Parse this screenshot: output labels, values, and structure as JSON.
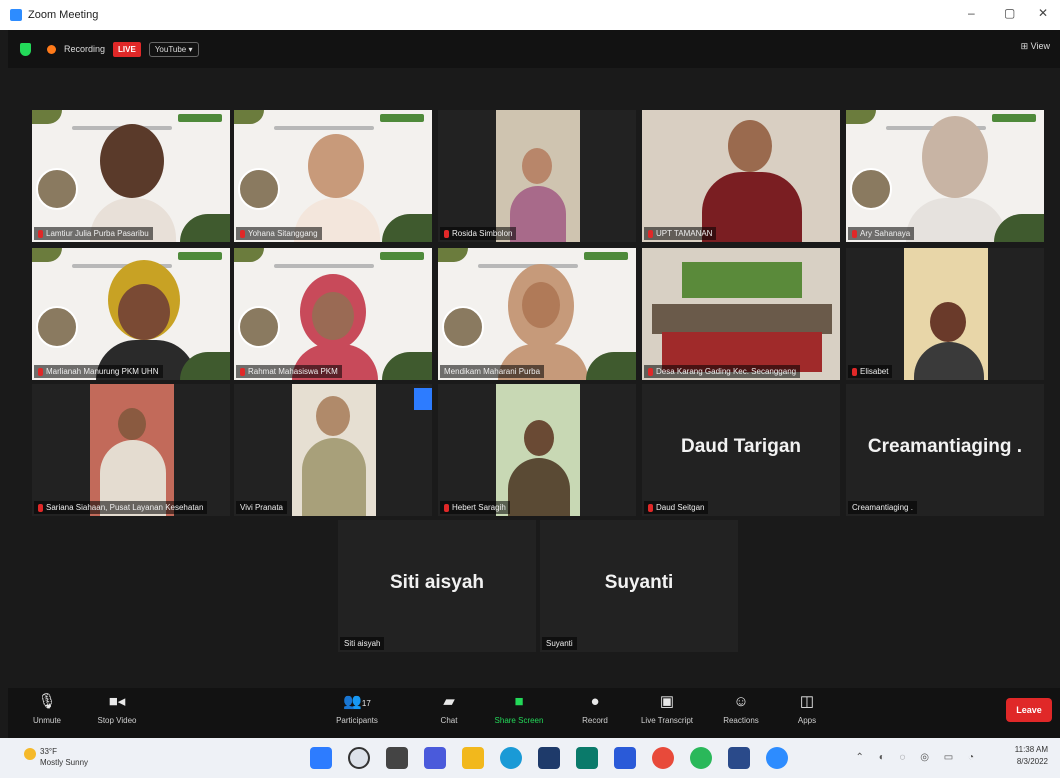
{
  "window": {
    "title": "Zoom Meeting",
    "minimize": "–",
    "maximize": "▢",
    "close": "✕"
  },
  "meeting_bar": {
    "recording_label": "Recording",
    "live_label": "LIVE",
    "stream_target": "YouTube ▾",
    "view_label": "⊞ View"
  },
  "tiles": [
    {
      "name": "Lamtiur Julia Purba Pasaribu",
      "type": "video"
    },
    {
      "name": "Yohana Sitanggang",
      "type": "video"
    },
    {
      "name": "Rosida Simbolon",
      "type": "video"
    },
    {
      "name": "UPT TAMANAN",
      "type": "video"
    },
    {
      "name": "Ary Sahanaya",
      "type": "video"
    },
    {
      "name": "Marlianah Manurung PKM UHN",
      "type": "video"
    },
    {
      "name": "Rahmat Mahasiswa PKM",
      "type": "video"
    },
    {
      "name": "Mendikam Maharani Purba",
      "type": "video",
      "active": true
    },
    {
      "name": "Desa Karang Gading Kec. Secanggang",
      "type": "video"
    },
    {
      "name": "Elisabet",
      "type": "video"
    },
    {
      "name": "Sariana Siahaan, Pusat Layanan Kesehatan",
      "type": "video"
    },
    {
      "name": "Vivi Pranata",
      "type": "video"
    },
    {
      "name": "Hebert Saragih",
      "type": "video"
    },
    {
      "name": "Daud Seitgan",
      "display": "Daud Tarigan",
      "type": "text"
    },
    {
      "name": "Creamantiaging .",
      "display": "Creamantiaging .",
      "type": "text"
    },
    {
      "name": "Siti aisyah",
      "display": "Siti aisyah",
      "type": "text"
    },
    {
      "name": "Suyanti",
      "display": "Suyanti",
      "type": "text"
    }
  ],
  "toolbar": {
    "unmute": "Unmute",
    "stop_video": "Stop Video",
    "participants": "Participants",
    "participants_count": "17",
    "chat": "Chat",
    "share_screen": "Share Screen",
    "record": "Record",
    "live_transcript": "Live Transcript",
    "reactions": "Reactions",
    "apps": "Apps",
    "leave": "Leave"
  },
  "taskbar": {
    "temperature": "33°F",
    "weather": "Mostly Sunny",
    "time": "11:38 AM",
    "date": "8/3/2022"
  },
  "colors": {
    "accent_green": "#23d959",
    "leave_red": "#e02828",
    "active_speaker": "#c6e06d"
  }
}
